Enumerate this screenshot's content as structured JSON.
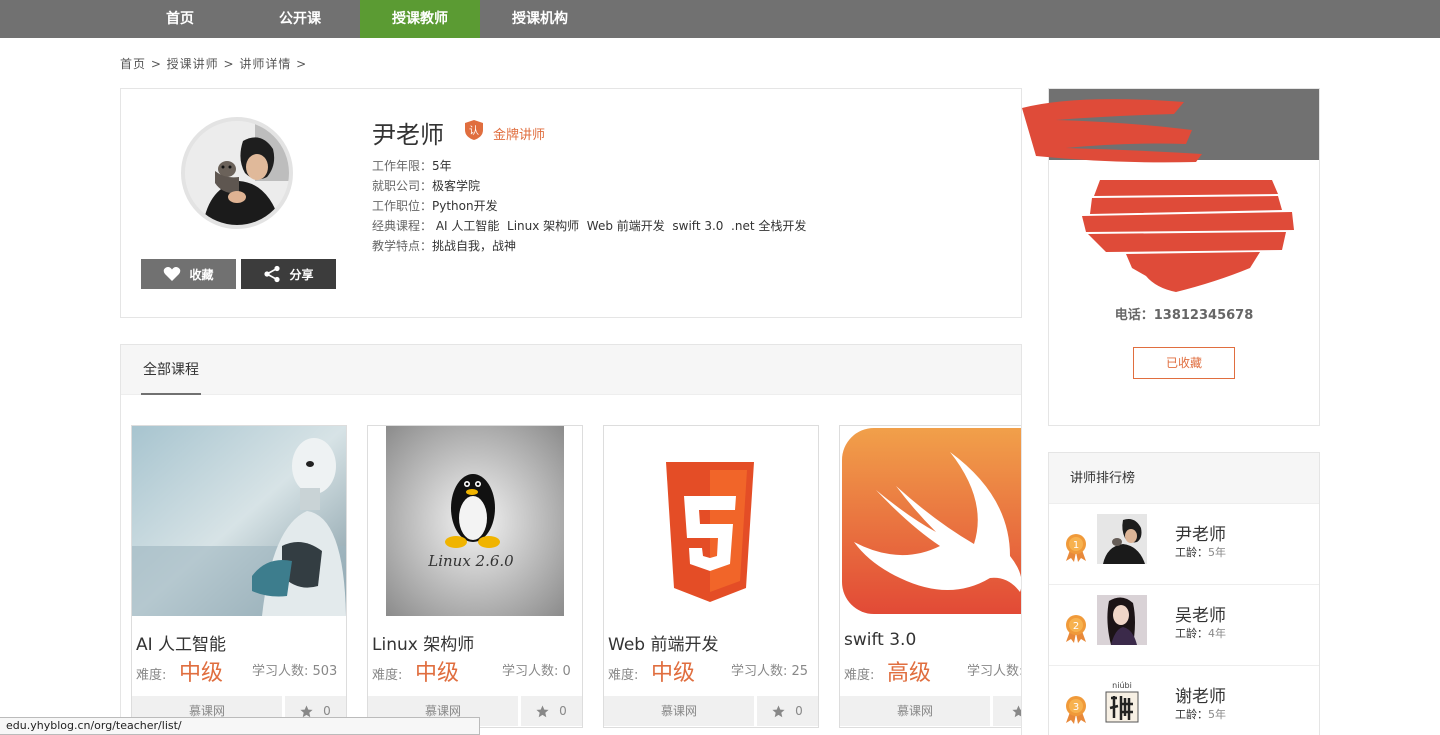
{
  "nav": {
    "items": [
      {
        "label": "首页",
        "active": false
      },
      {
        "label": "公开课",
        "active": false
      },
      {
        "label": "授课教师",
        "active": true
      },
      {
        "label": "授课机构",
        "active": false
      }
    ],
    "active_color": "#5b9b33"
  },
  "breadcrumb": "首页 > 授课讲师 > 讲师详情 >",
  "teacher": {
    "name": "尹老师",
    "badge": "金牌讲师",
    "info": [
      {
        "label": "工作年限：",
        "value": "5年"
      },
      {
        "label": "就职公司：",
        "value": "极客学院"
      },
      {
        "label": "工作职位：",
        "value": "Python开发"
      },
      {
        "label": "经典课程：",
        "value": " AI 人工智能  Linux 架构师  Web 前端开发  swift 3.0  .net 全栈开发"
      },
      {
        "label": "教学特点：",
        "value": "挑战自我，战神"
      }
    ],
    "fav_label": "收藏",
    "share_label": "分享"
  },
  "courses": {
    "tab_label": "全部课程",
    "diff_label": "难度:",
    "learn_prefix": "学习人数: ",
    "items": [
      {
        "title": "AI 人工智能",
        "difficulty": "中级",
        "students": "503",
        "org": "慕课网",
        "stars": "0",
        "thumb": "robot-image"
      },
      {
        "title": "Linux 架构师",
        "difficulty": "中级",
        "students": "0",
        "org": "慕课网",
        "stars": "0",
        "thumb": "linux-penguin-image"
      },
      {
        "title": "Web 前端开发",
        "difficulty": "中级",
        "students": "25",
        "org": "慕课网",
        "stars": "0",
        "thumb": "html5-logo-image"
      },
      {
        "title": "swift 3.0",
        "difficulty": "高级",
        "students": "",
        "org": "慕课网",
        "stars": "",
        "thumb": "swift-logo-image"
      }
    ]
  },
  "org": {
    "phone": "电话：13812345678",
    "collected_label": "已收藏"
  },
  "ranking": {
    "title": "讲师排行榜",
    "age_label": "工龄：",
    "items": [
      {
        "rank": "1",
        "name": "尹老师",
        "age": "5年"
      },
      {
        "rank": "2",
        "name": "吴老师",
        "age": "4年"
      },
      {
        "rank": "3",
        "name": "谢老师",
        "age": "5年",
        "avatar_text": "niúbi"
      }
    ]
  },
  "status_url": "edu.yhyblog.cn/org/teacher/list/"
}
